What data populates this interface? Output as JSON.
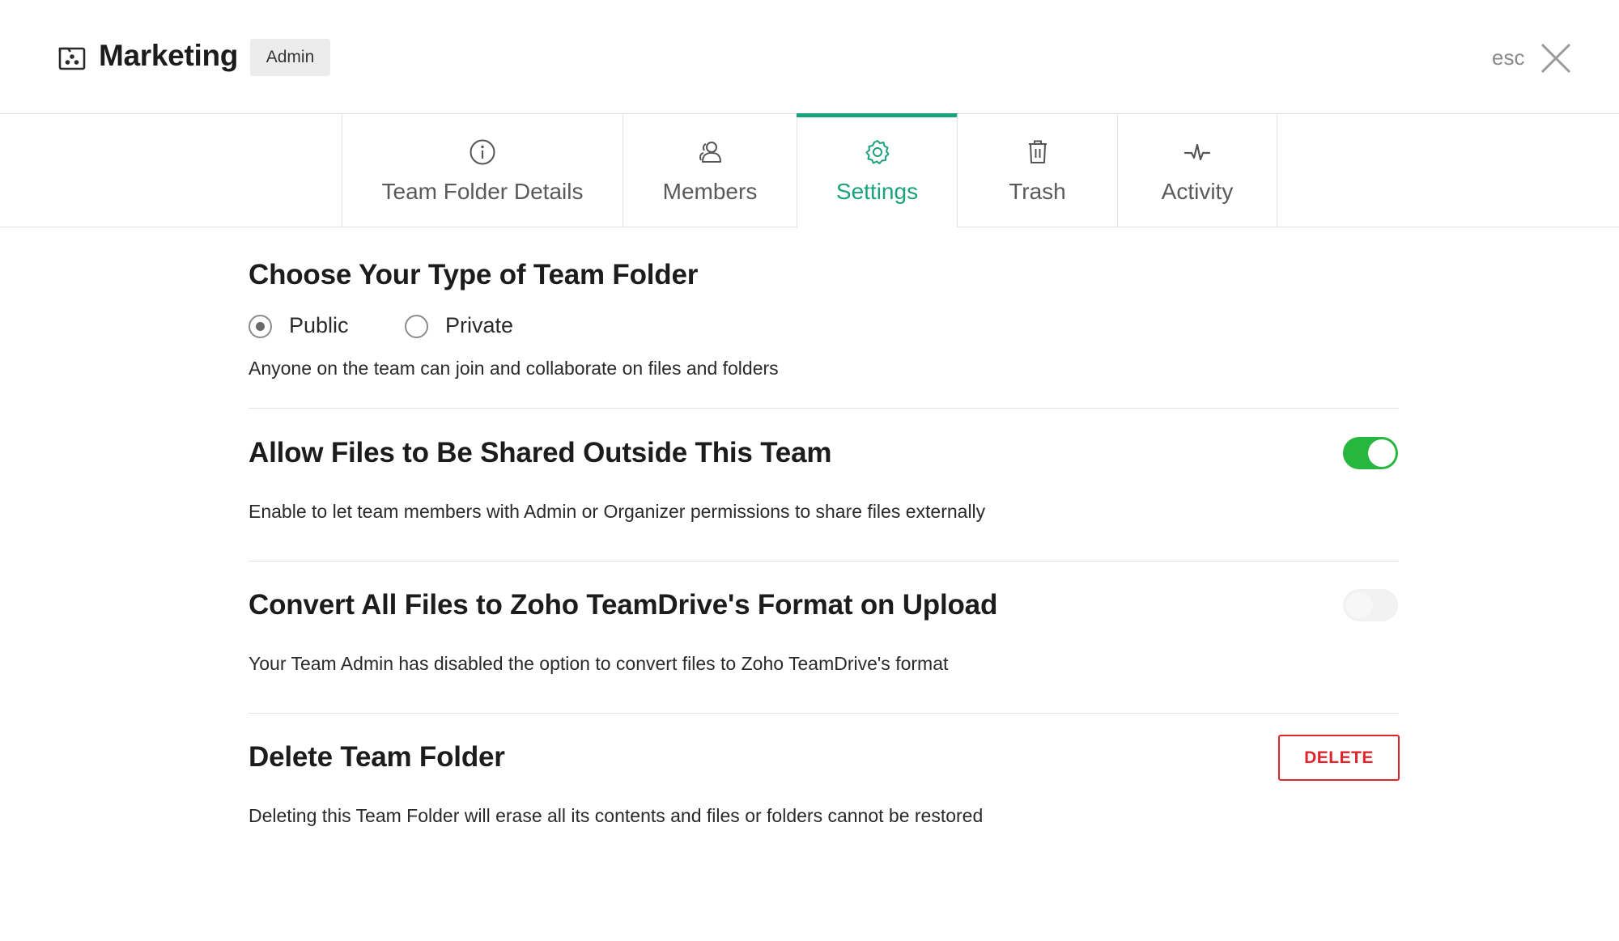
{
  "header": {
    "title": "Marketing",
    "role_badge": "Admin",
    "esc_label": "esc"
  },
  "tabs": [
    {
      "label": "Team Folder Details",
      "icon": "info-icon",
      "active": false
    },
    {
      "label": "Members",
      "icon": "members-icon",
      "active": false
    },
    {
      "label": "Settings",
      "icon": "gear-icon",
      "active": true
    },
    {
      "label": "Trash",
      "icon": "trash-icon",
      "active": false
    },
    {
      "label": "Activity",
      "icon": "activity-icon",
      "active": false
    }
  ],
  "folder_type": {
    "title": "Choose Your Type of Team Folder",
    "options": [
      {
        "label": "Public",
        "checked": true
      },
      {
        "label": "Private",
        "checked": false
      }
    ],
    "description": "Anyone on the team can join and collaborate on files and folders"
  },
  "external_sharing": {
    "title": "Allow Files to Be Shared Outside This Team",
    "description": "Enable to let team members with Admin or Organizer permissions to share files externally",
    "enabled": true
  },
  "convert_files": {
    "title": "Convert All Files to Zoho TeamDrive's Format on Upload",
    "description": "Your Team Admin has disabled the option to convert files to Zoho TeamDrive's format",
    "enabled": false,
    "disabled": true
  },
  "delete_folder": {
    "title": "Delete Team Folder",
    "description": "Deleting this Team Folder will erase all its contents and files or folders cannot be restored",
    "button_label": "DELETE"
  },
  "colors": {
    "accent": "#1aa37a",
    "toggle_on": "#27b63e",
    "danger": "#e0242c"
  }
}
